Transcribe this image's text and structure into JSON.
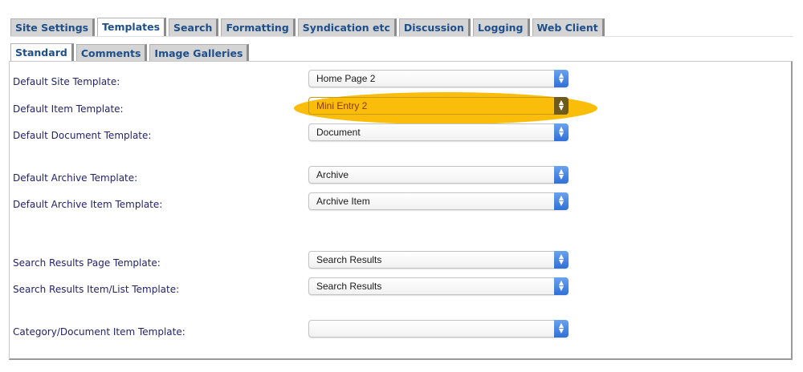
{
  "tabs_top": [
    "Site Settings",
    "Templates",
    "Search",
    "Formatting",
    "Syndication etc",
    "Discussion",
    "Logging",
    "Web Client"
  ],
  "tabs_sub": [
    "Standard",
    "Comments",
    "Image Galleries"
  ],
  "fields": {
    "default_site": {
      "label": "Default Site Template:",
      "value": "Home Page 2"
    },
    "default_item": {
      "label": "Default Item Template:",
      "value": "Mini Entry 2"
    },
    "default_document": {
      "label": "Default Document Template:",
      "value": "Document"
    },
    "default_archive": {
      "label": "Default Archive Template:",
      "value": "Archive"
    },
    "default_archive_item": {
      "label": "Default Archive Item Template:",
      "value": "Archive Item"
    },
    "search_results_page": {
      "label": "Search Results Page Template:",
      "value": "Search Results"
    },
    "search_results_item": {
      "label": "Search Results Item/List Template:",
      "value": "Search Results"
    },
    "category_document_item": {
      "label": "Category/Document Item Template:",
      "value": ""
    }
  },
  "colors": {
    "tab_text": "#1e4f8a",
    "label_text": "#23236b",
    "highlight": "#f9bd0a",
    "select_arrow": "#2f6fd9"
  }
}
